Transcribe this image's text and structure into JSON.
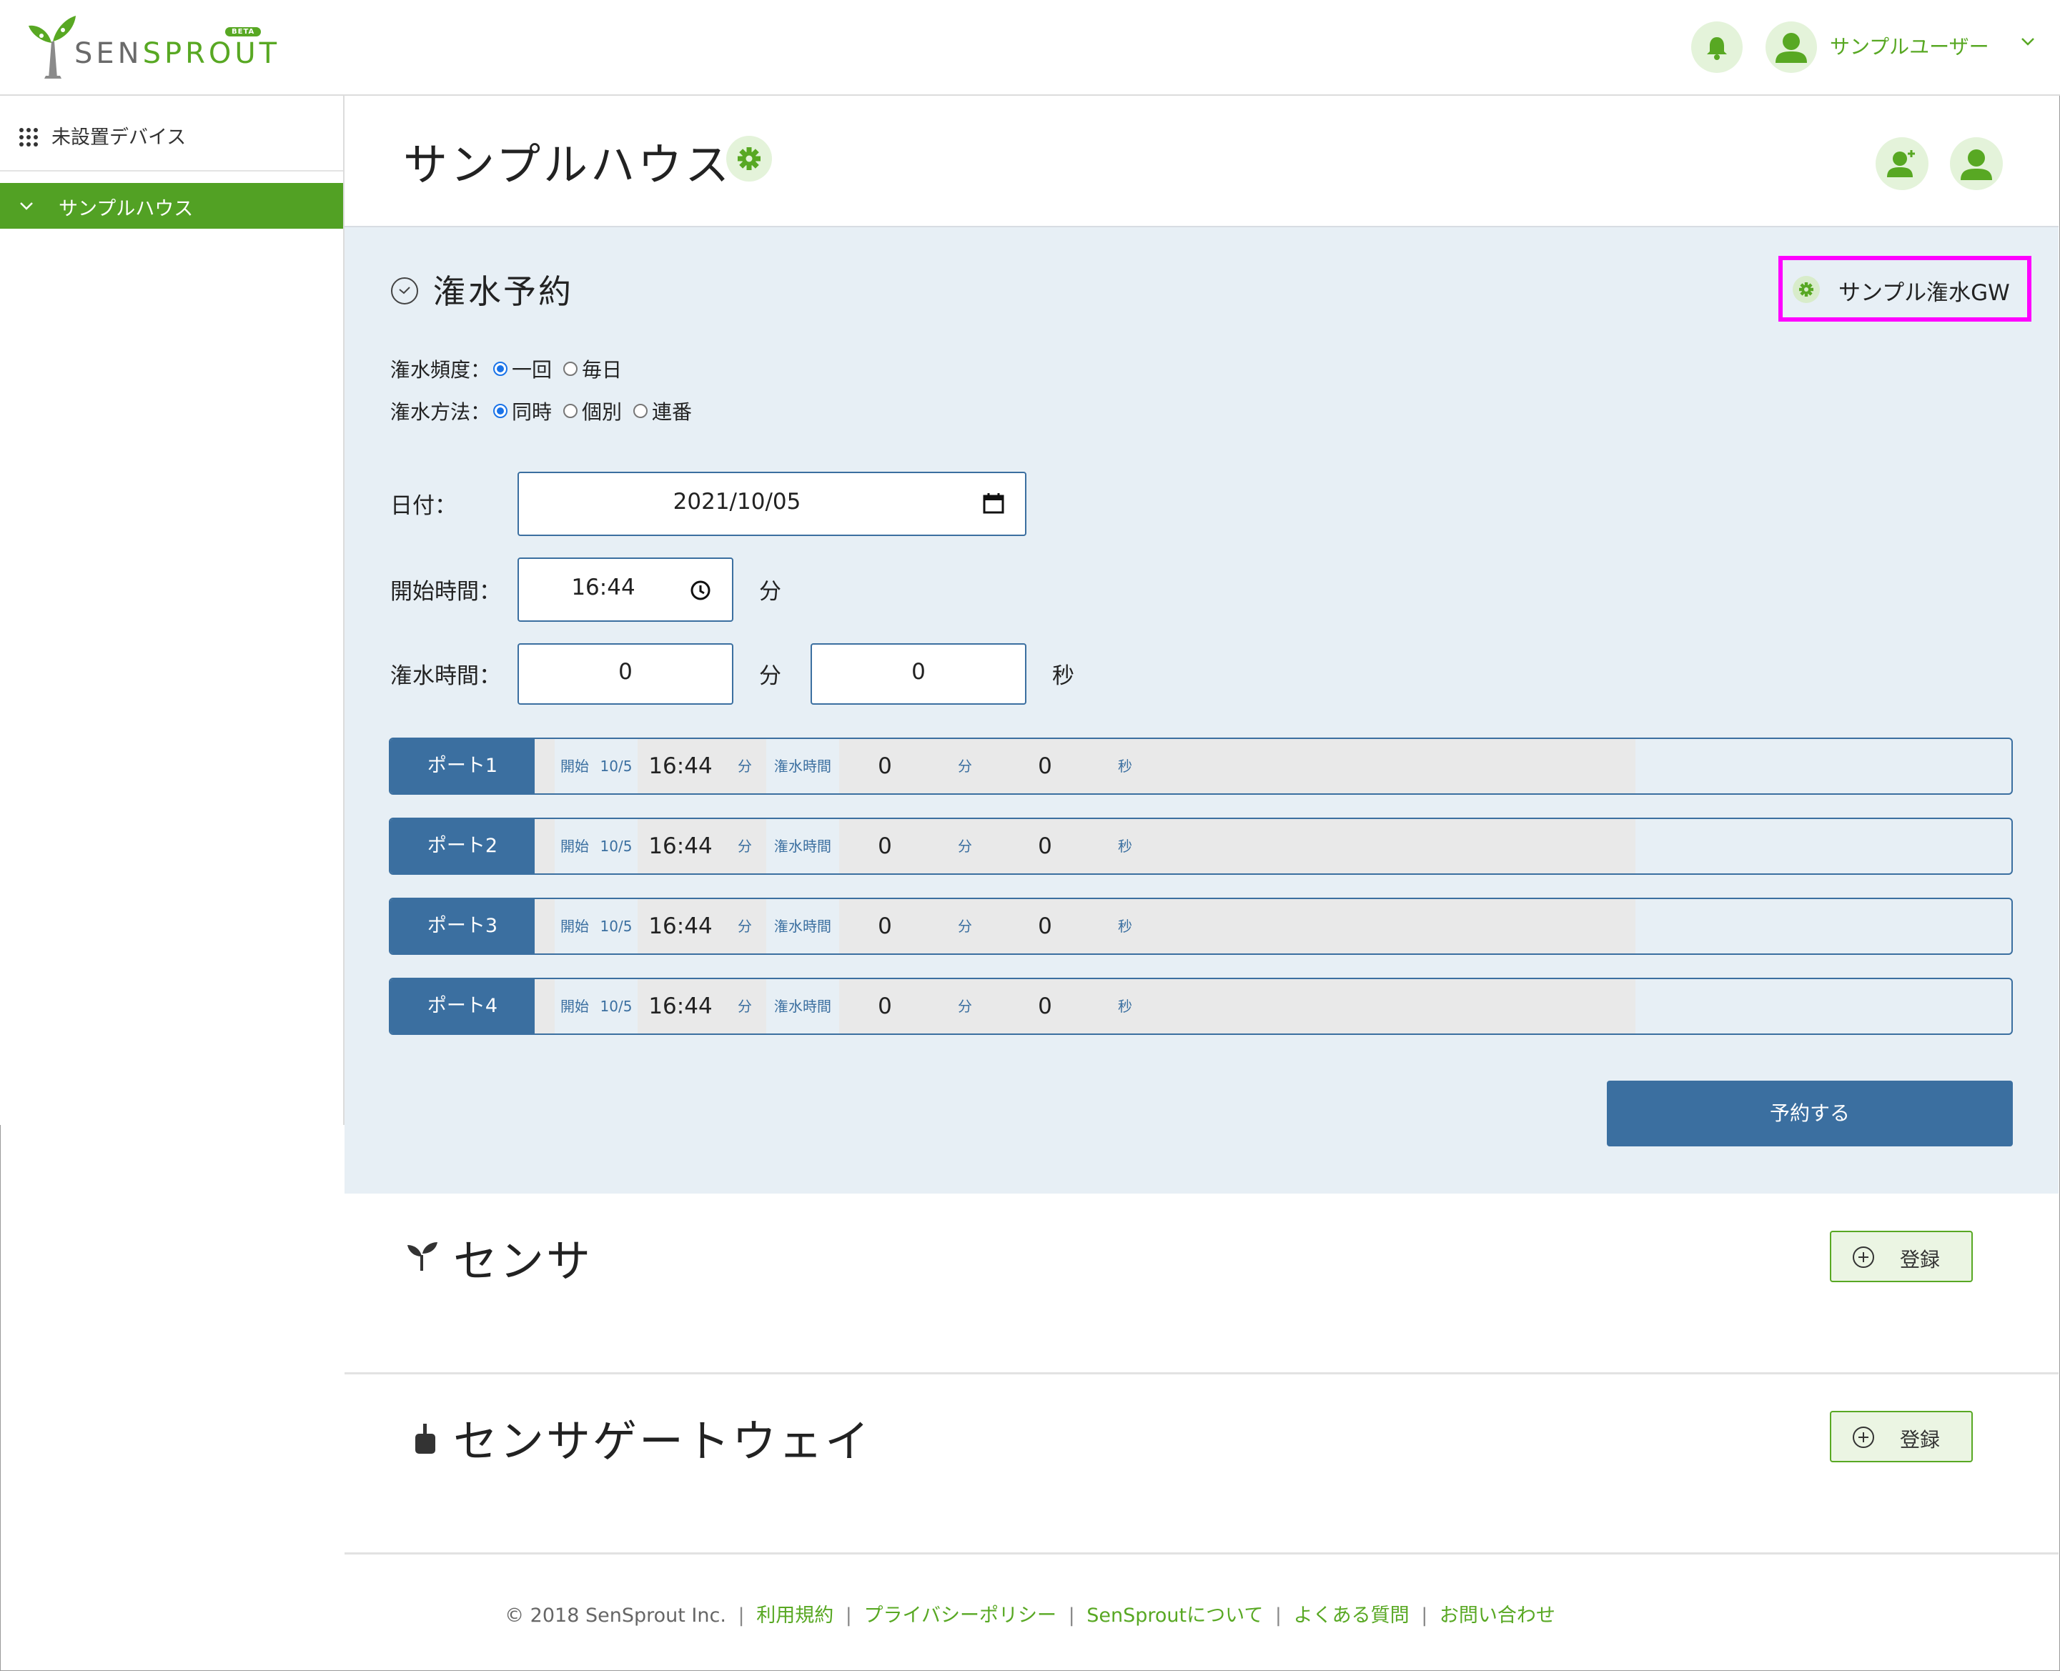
{
  "header": {
    "logo_text_1": "SEN",
    "logo_text_2": "SPROUT",
    "beta_badge": "BETA",
    "user_name": "サンプルユーザー"
  },
  "sidebar": {
    "unplaced_devices": "未設置デバイス",
    "items": [
      {
        "label": "サンプルハウス",
        "active": true
      }
    ]
  },
  "page": {
    "title": "サンプルハウス"
  },
  "reservation": {
    "title": "潅水予約",
    "gateway_label": "サンプル潅水GW",
    "frequency_label": "潅水頻度：",
    "frequency_options": [
      {
        "label": "一回",
        "checked": true
      },
      {
        "label": "毎日",
        "checked": false
      }
    ],
    "method_label": "潅水方法：",
    "method_options": [
      {
        "label": "同時",
        "checked": true
      },
      {
        "label": "個別",
        "checked": false
      },
      {
        "label": "連番",
        "checked": false
      }
    ],
    "date_label": "日付：",
    "date_value": "2021/10/05",
    "start_label": "開始時間：",
    "start_value": "16:44",
    "start_unit": "分",
    "duration_label": "潅水時間：",
    "duration_min": "0",
    "duration_min_unit": "分",
    "duration_sec": "0",
    "duration_sec_unit": "秒",
    "ports": [
      {
        "name": "ポート1",
        "start_label": "開始",
        "date": "10/5",
        "time": "16:44",
        "time_unit": "分",
        "duration_label": "潅水時間",
        "min": "0",
        "min_unit": "分",
        "sec": "0",
        "sec_unit": "秒"
      },
      {
        "name": "ポート2",
        "start_label": "開始",
        "date": "10/5",
        "time": "16:44",
        "time_unit": "分",
        "duration_label": "潅水時間",
        "min": "0",
        "min_unit": "分",
        "sec": "0",
        "sec_unit": "秒"
      },
      {
        "name": "ポート3",
        "start_label": "開始",
        "date": "10/5",
        "time": "16:44",
        "time_unit": "分",
        "duration_label": "潅水時間",
        "min": "0",
        "min_unit": "分",
        "sec": "0",
        "sec_unit": "秒"
      },
      {
        "name": "ポート4",
        "start_label": "開始",
        "date": "10/5",
        "time": "16:44",
        "time_unit": "分",
        "duration_label": "潅水時間",
        "min": "0",
        "min_unit": "分",
        "sec": "0",
        "sec_unit": "秒"
      }
    ],
    "submit_label": "予約する"
  },
  "sensor": {
    "title": "センサ",
    "register_label": "登録"
  },
  "gateway": {
    "title": "センサゲートウェイ",
    "register_label": "登録"
  },
  "footer": {
    "copyright": "© 2018 SenSprout Inc.",
    "links": [
      "利用規約",
      "プライバシーポリシー",
      "SenSproutについて",
      "よくある質問",
      "お問い合わせ"
    ],
    "separator": "|"
  },
  "colors": {
    "brand_green": "#58a823",
    "accent_blue": "#3b6fa0",
    "highlight": "#ff00ff"
  }
}
